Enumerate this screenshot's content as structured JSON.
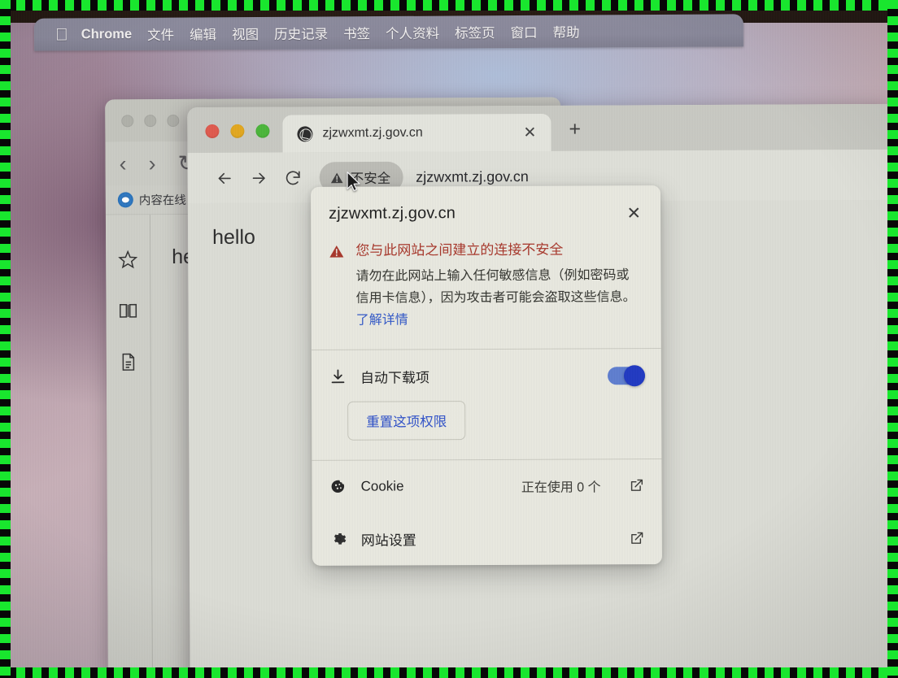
{
  "menubar": {
    "apple_icon": "apple-logo-icon",
    "items": [
      {
        "label": "Chrome",
        "bold": true
      },
      {
        "label": "文件",
        "bold": false
      },
      {
        "label": "编辑",
        "bold": false
      },
      {
        "label": "视图",
        "bold": false
      },
      {
        "label": "历史记录",
        "bold": false
      },
      {
        "label": "书签",
        "bold": false
      },
      {
        "label": "个人资料",
        "bold": false
      },
      {
        "label": "标签页",
        "bold": false
      },
      {
        "label": "窗口",
        "bold": false
      },
      {
        "label": "帮助",
        "bold": false
      }
    ]
  },
  "background_window": {
    "bookmark_label": "内容在线",
    "page_text": "hello",
    "sidebar_icons": [
      "star-icon",
      "book-icon",
      "document-icon"
    ],
    "nav_back": "‹",
    "nav_forward": "›"
  },
  "chrome_window": {
    "tab": {
      "favicon": "globe-favicon-icon",
      "title": "zjzwxmt.zj.gov.cn",
      "close_label": "✕"
    },
    "new_tab_label": "+",
    "toolbar": {
      "back_icon": "arrow-left-icon",
      "forward_icon": "arrow-right-icon",
      "reload_icon": "reload-icon",
      "security_chip": "不安全",
      "security_chip_icon": "warning-triangle-icon",
      "url": "zjzwxmt.zj.gov.cn"
    },
    "page_text": "hello"
  },
  "popup": {
    "origin": "zjzwxmt.zj.gov.cn",
    "close_label": "✕",
    "warning": {
      "icon": "warning-triangle-icon",
      "title": "您与此网站之间建立的连接不安全",
      "description": "请勿在此网站上输入任何敏感信息（例如密码或信用卡信息），因为攻击者可能会盗取这些信息。",
      "link_text": "了解详情"
    },
    "permission": {
      "icon": "download-icon",
      "label": "自动下载项",
      "toggle_state": "on",
      "reset_button": "重置这项权限"
    },
    "items": [
      {
        "icon": "cookie-icon",
        "label": "Cookie",
        "value": "正在使用 0 个",
        "external_icon": "external-link-icon"
      },
      {
        "icon": "gear-icon",
        "label": "网站设置",
        "value": "",
        "external_icon": "external-link-icon"
      }
    ]
  },
  "colors": {
    "warning_red": "#a8372b",
    "link_blue": "#3258c8",
    "toggle_blue": "#2039c2",
    "recording_green": "#19e62e"
  }
}
